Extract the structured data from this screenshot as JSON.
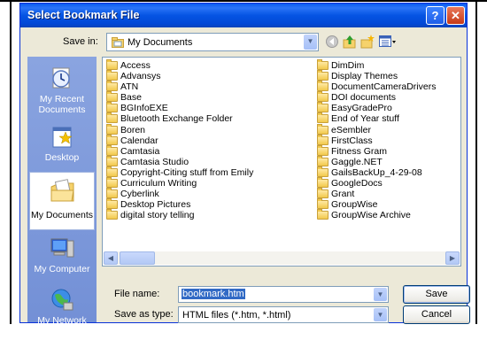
{
  "dialog": {
    "title": "Select Bookmark File",
    "help_glyph": "?",
    "close_glyph": "✕"
  },
  "save_in": {
    "label": "Save in:",
    "value": "My Documents"
  },
  "toolbar": {
    "icons": [
      "back-icon",
      "up-folder-icon",
      "new-folder-icon",
      "views-menu-icon"
    ]
  },
  "places": [
    {
      "label": "My Recent Documents",
      "icon": "recent-documents-icon"
    },
    {
      "label": "Desktop",
      "icon": "desktop-icon"
    },
    {
      "label": "My Documents",
      "icon": "my-documents-icon",
      "active": true
    },
    {
      "label": "My Computer",
      "icon": "my-computer-icon"
    },
    {
      "label": "My Network",
      "icon": "my-network-icon"
    }
  ],
  "files": {
    "column1": [
      "Access",
      "Advansys",
      "ATN",
      "Base",
      "BGInfoEXE",
      "Bluetooth Exchange Folder",
      "Boren",
      "Calendar",
      "Camtasia",
      "Camtasia Studio",
      "Copyright-Citing stuff from Emily",
      "Curriculum Writing",
      "Cyberlink",
      "Desktop Pictures",
      "digital story telling"
    ],
    "column2": [
      "DimDim",
      "Display Themes",
      "DocumentCameraDrivers",
      "DOI documents",
      "EasyGradePro",
      "End of Year stuff",
      "eSembler",
      "FirstClass",
      "Fitness Gram",
      "Gaggle.NET",
      "GailsBackUp_4-29-08",
      "GoogleDocs",
      "Grant",
      "GroupWise",
      "GroupWise Archive"
    ]
  },
  "file_name": {
    "label": "File name:",
    "value": "bookmark.htm"
  },
  "save_as_type": {
    "label": "Save as type:",
    "value": "HTML files (*.htm, *.html)"
  },
  "buttons": {
    "save": "Save",
    "cancel": "Cancel"
  },
  "colors": {
    "title_bar": "#0554e3",
    "places_bar": "#7b96d8",
    "selection": "#316ac5",
    "dialog_face": "#ece9d8"
  }
}
